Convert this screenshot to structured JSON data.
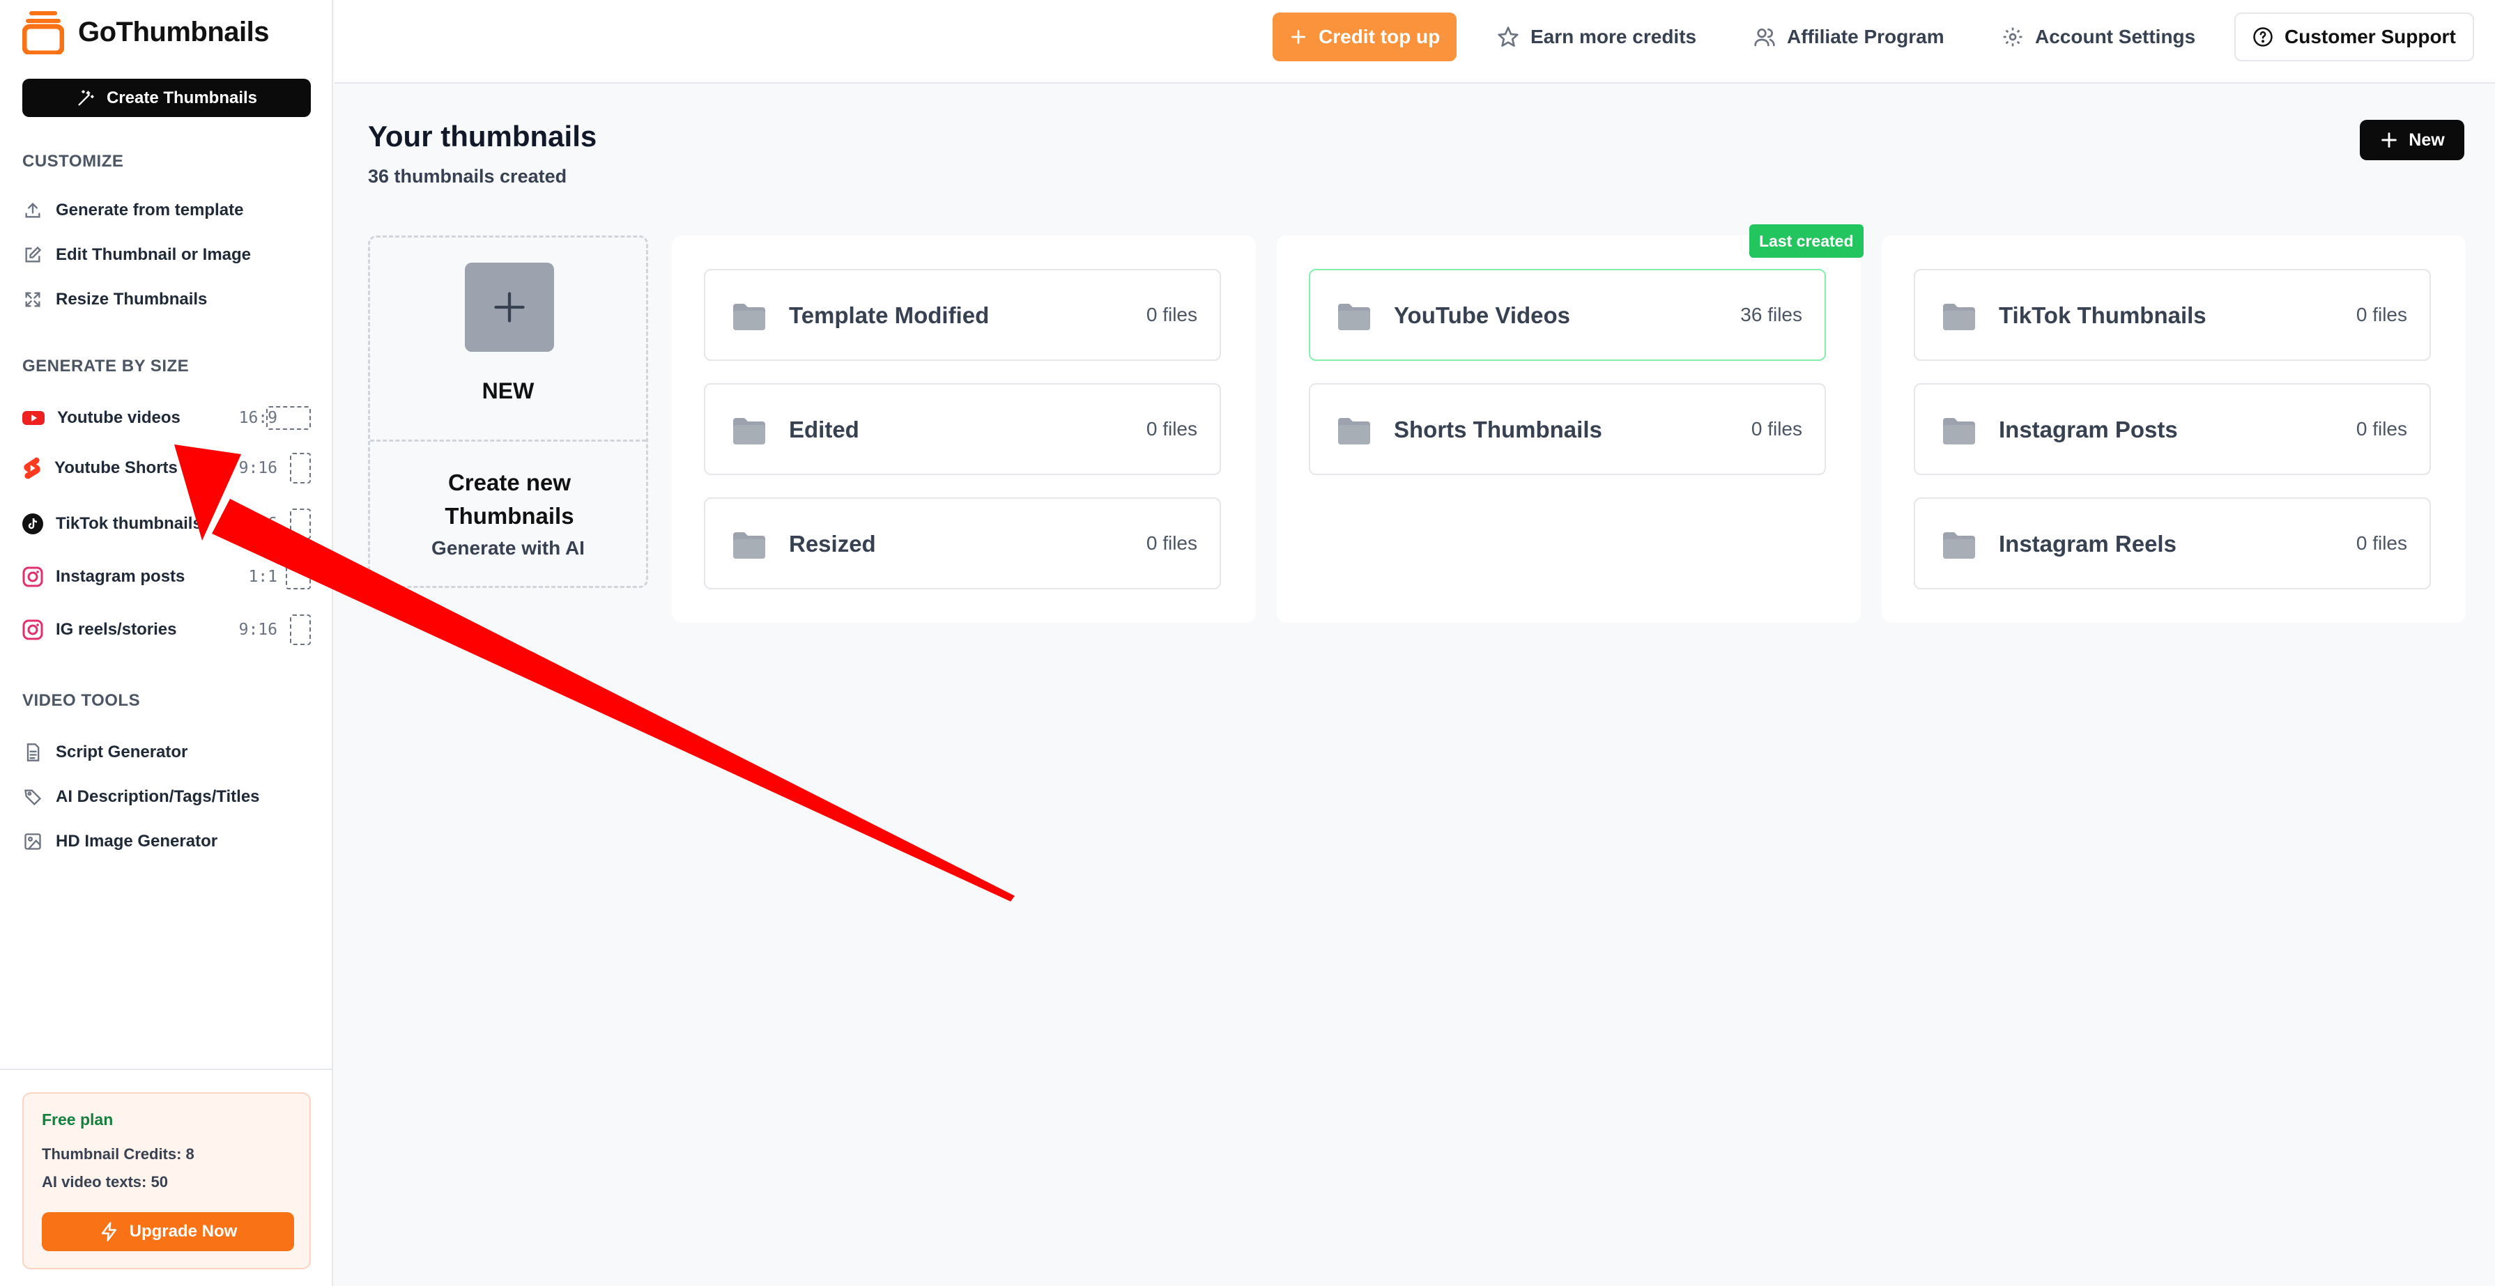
{
  "app": {
    "name": "GoThumbnails"
  },
  "sidebar": {
    "create_button": "Create Thumbnails",
    "customize": {
      "title": "CUSTOMIZE",
      "items": [
        {
          "label": "Generate from template",
          "icon": "upload-icon"
        },
        {
          "label": "Edit Thumbnail or Image",
          "icon": "edit-icon"
        },
        {
          "label": "Resize Thumbnails",
          "icon": "resize-icon"
        }
      ]
    },
    "generate_by_size": {
      "title": "GENERATE BY SIZE",
      "items": [
        {
          "label": "Youtube videos",
          "ratio": "16:9",
          "icon": "youtube-icon"
        },
        {
          "label": "Youtube Shorts",
          "ratio": "9:16",
          "icon": "youtube-shorts-icon"
        },
        {
          "label": "TikTok thumbnails",
          "ratio": "9:16",
          "icon": "tiktok-icon"
        },
        {
          "label": "Instagram posts",
          "ratio": "1:1",
          "icon": "instagram-icon"
        },
        {
          "label": "IG reels/stories",
          "ratio": "9:16",
          "icon": "instagram-icon"
        }
      ]
    },
    "video_tools": {
      "title": "VIDEO TOOLS",
      "items": [
        {
          "label": "Script Generator",
          "icon": "document-icon"
        },
        {
          "label": "AI Description/Tags/Titles",
          "icon": "tag-icon"
        },
        {
          "label": "HD Image Generator",
          "icon": "image-icon"
        }
      ]
    },
    "plan": {
      "title": "Free plan",
      "credits": "Thumbnail Credits: 8",
      "ai_texts": "AI video texts: 50",
      "upgrade": "Upgrade Now"
    }
  },
  "topbar": {
    "credit_top_up": "Credit top up",
    "earn_credits": "Earn more credits",
    "affiliate": "Affiliate Program",
    "account_settings": "Account Settings",
    "support": "Customer Support"
  },
  "main": {
    "title": "Your thumbnails",
    "subtitle": "36 thumbnails created",
    "new_button": "New",
    "new_card": {
      "label": "NEW",
      "create_text": "Create new Thumbnails",
      "sub_text": "Generate with AI"
    },
    "last_created_badge": "Last created",
    "groups": [
      {
        "folders": [
          {
            "name": "Template Modified",
            "count": "0 files"
          },
          {
            "name": "Edited",
            "count": "0 files"
          },
          {
            "name": "Resized",
            "count": "0 files"
          }
        ]
      },
      {
        "folders": [
          {
            "name": "YouTube Videos",
            "count": "36 files"
          },
          {
            "name": "Shorts Thumbnails",
            "count": "0 files"
          }
        ]
      },
      {
        "folders": [
          {
            "name": "TikTok Thumbnails",
            "count": "0 files"
          },
          {
            "name": "Instagram Posts",
            "count": "0 files"
          },
          {
            "name": "Instagram Reels",
            "count": "0 files"
          }
        ]
      }
    ]
  },
  "colors": {
    "accent_orange": "#f97316",
    "credit_orange": "#fb923c",
    "badge_green": "#22c55e",
    "arrow_red": "#ff0000"
  }
}
